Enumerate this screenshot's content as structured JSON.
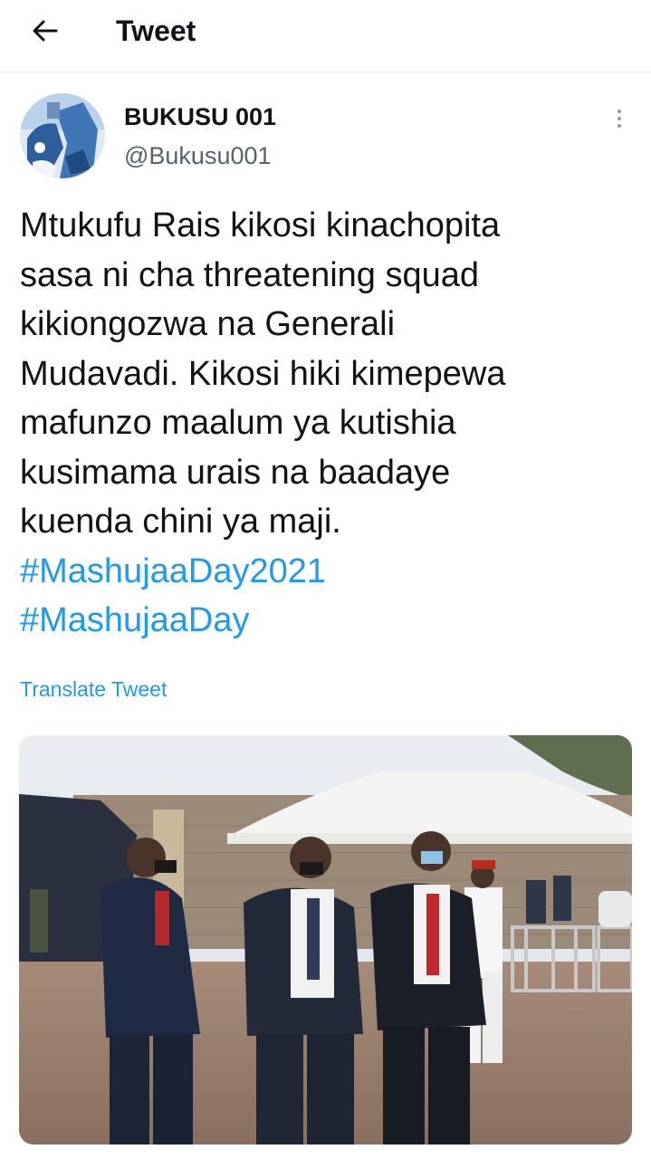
{
  "header": {
    "title": "Tweet",
    "back_icon": "arrow-left-icon"
  },
  "author": {
    "name": "BUKUSU 001",
    "handle": "@Bukusu001",
    "more_icon": "more-vertical-icon"
  },
  "tweet": {
    "lines": [
      "Mtukufu Rais  kikosi kinachopita",
      "sasa ni cha threatening squad",
      "kikiongozwa na Generali",
      "Mudavadi. Kikosi hiki kimepewa",
      "mafunzo maalum ya kutishia",
      "kusimama urais na baadaye",
      "kuenda chini ya maji."
    ],
    "hashtags": [
      "#MashujaaDay2021",
      "#MashujaaDay"
    ],
    "translate_label": "Translate Tweet"
  },
  "colors": {
    "accent": "#1d9bf0",
    "text": "#0f1419",
    "secondary": "#536471",
    "divider": "#e6ecf0"
  }
}
